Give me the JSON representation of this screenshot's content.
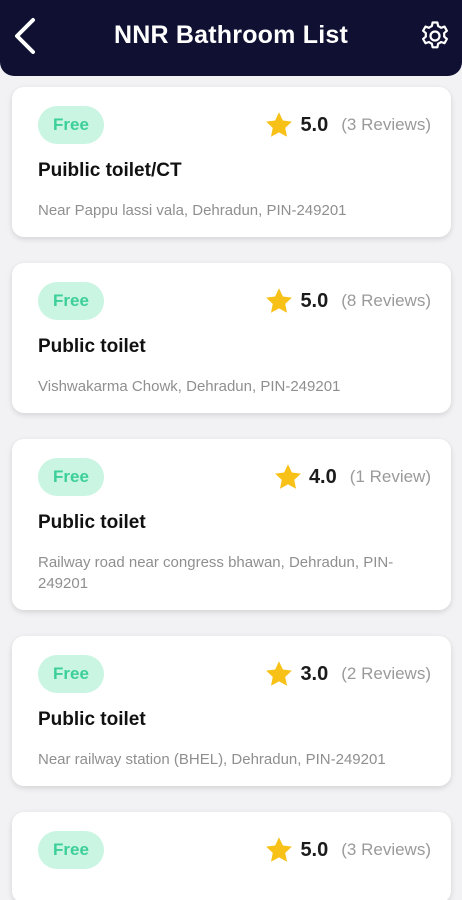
{
  "header": {
    "title": "NNR Bathroom List",
    "back_icon": "chevron-left-icon",
    "settings_icon": "gear-icon"
  },
  "colors": {
    "header_bg": "#0f1032",
    "badge_bg": "#c9f5e2",
    "badge_text": "#3dcf9a",
    "star": "#f7c117"
  },
  "cards": [
    {
      "badge": "Free",
      "rating": "5.0",
      "reviews": "(3 Reviews)",
      "name": "Puiblic toilet/CT",
      "address": "Near Pappu lassi vala, Dehradun, PIN-249201"
    },
    {
      "badge": "Free",
      "rating": "5.0",
      "reviews": "(8 Reviews)",
      "name": "Public toilet",
      "address": "Vishwakarma Chowk, Dehradun, PIN-249201"
    },
    {
      "badge": "Free",
      "rating": "4.0",
      "reviews": "(1 Review)",
      "name": "Public toilet",
      "address": "Railway road near congress bhawan, Dehradun, PIN-249201"
    },
    {
      "badge": "Free",
      "rating": "3.0",
      "reviews": "(2 Reviews)",
      "name": "Public toilet",
      "address": "Near railway station (BHEL), Dehradun, PIN-249201"
    },
    {
      "badge": "Free",
      "rating": "5.0",
      "reviews": "(3 Reviews)",
      "name": "",
      "address": ""
    }
  ]
}
